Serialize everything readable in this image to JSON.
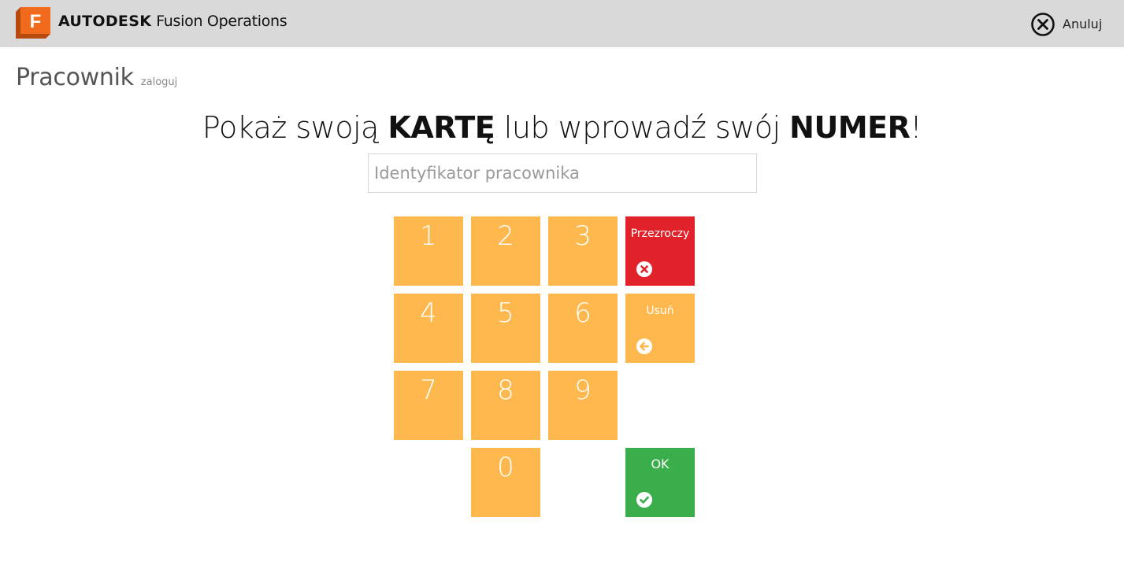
{
  "app": {
    "logo_letter": "F",
    "brand_bold": "AUTODESK",
    "brand_rest": "Fusion Operations",
    "cancel_label": "Anuluj"
  },
  "page": {
    "title": "Pracownik",
    "subtitle": "zaloguj"
  },
  "heading": {
    "part1": "Pokaż swoją ",
    "bold1": "KARTĘ",
    "part2": " lub wprowadź swój ",
    "bold2": "NUMER",
    "part3": "!"
  },
  "input": {
    "placeholder": "Identyfikator pracownika",
    "value": ""
  },
  "keypad": {
    "digits": [
      "1",
      "2",
      "3",
      "4",
      "5",
      "6",
      "7",
      "8",
      "9",
      "0"
    ],
    "clear_label": "Przezroczy",
    "delete_label": "Usuń",
    "ok_label": "OK"
  },
  "colors": {
    "digit_key": "#ffb84d",
    "clear_key": "#e1222a",
    "ok_key": "#3aae4a",
    "topbar": "#d9d9d9",
    "logo": "#f26b1d"
  },
  "icons": {
    "logo": "fusion-logo-icon",
    "cancel": "close-circle-icon",
    "clear": "times-circle-icon",
    "delete": "arrow-left-circle-icon",
    "ok": "check-circle-icon"
  }
}
